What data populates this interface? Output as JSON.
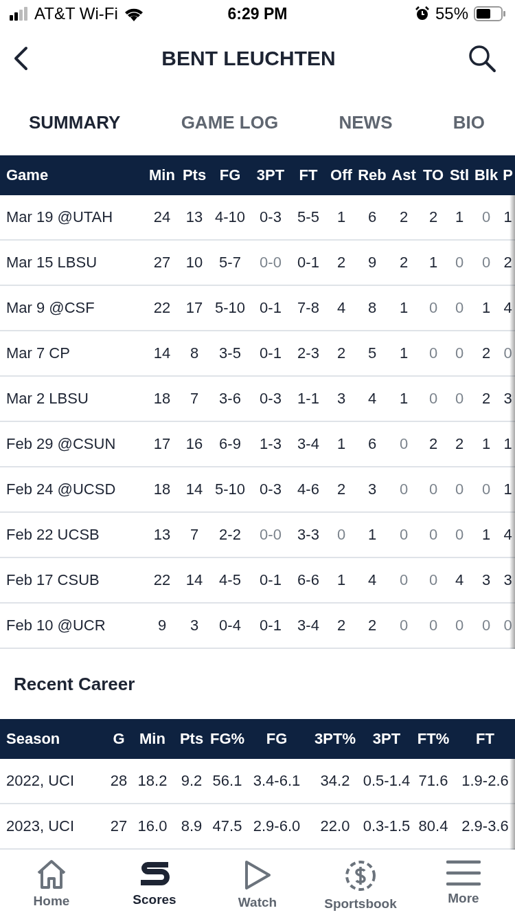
{
  "status_bar": {
    "carrier": "AT&T Wi-Fi",
    "time": "6:29 PM",
    "battery": "55%"
  },
  "header": {
    "title": "BENT LEUCHTEN"
  },
  "tabs": [
    {
      "label": "SUMMARY",
      "selected": true
    },
    {
      "label": "GAME LOG",
      "selected": false
    },
    {
      "label": "NEWS",
      "selected": false
    },
    {
      "label": "BIO",
      "selected": false
    }
  ],
  "game_log": {
    "columns": [
      "Game",
      "Min",
      "Pts",
      "FG",
      "3PT",
      "FT",
      "Off",
      "Reb",
      "Ast",
      "TO",
      "Stl",
      "Blk",
      "P"
    ],
    "rows": [
      {
        "cells": [
          "Mar 19 @UTAH",
          "24",
          "13",
          "4-10",
          "0-3",
          "5-5",
          "1",
          "6",
          "2",
          "2",
          "1",
          "0",
          "1"
        ],
        "muted": [
          false,
          false,
          false,
          false,
          false,
          false,
          false,
          false,
          false,
          false,
          false,
          true,
          false
        ]
      },
      {
        "cells": [
          "Mar 15 LBSU",
          "27",
          "10",
          "5-7",
          "0-0",
          "0-1",
          "2",
          "9",
          "2",
          "1",
          "0",
          "0",
          "2"
        ],
        "muted": [
          false,
          false,
          false,
          false,
          true,
          false,
          false,
          false,
          false,
          false,
          true,
          true,
          false
        ]
      },
      {
        "cells": [
          "Mar 9 @CSF",
          "22",
          "17",
          "5-10",
          "0-1",
          "7-8",
          "4",
          "8",
          "1",
          "0",
          "0",
          "1",
          "4"
        ],
        "muted": [
          false,
          false,
          false,
          false,
          false,
          false,
          false,
          false,
          false,
          true,
          true,
          false,
          false
        ]
      },
      {
        "cells": [
          "Mar 7 CP",
          "14",
          "8",
          "3-5",
          "0-1",
          "2-3",
          "2",
          "5",
          "1",
          "0",
          "0",
          "2",
          "0"
        ],
        "muted": [
          false,
          false,
          false,
          false,
          false,
          false,
          false,
          false,
          false,
          true,
          true,
          false,
          true
        ]
      },
      {
        "cells": [
          "Mar 2 LBSU",
          "18",
          "7",
          "3-6",
          "0-3",
          "1-1",
          "3",
          "4",
          "1",
          "0",
          "0",
          "2",
          "3"
        ],
        "muted": [
          false,
          false,
          false,
          false,
          false,
          false,
          false,
          false,
          false,
          true,
          true,
          false,
          false
        ]
      },
      {
        "cells": [
          "Feb 29 @CSUN",
          "17",
          "16",
          "6-9",
          "1-3",
          "3-4",
          "1",
          "6",
          "0",
          "2",
          "2",
          "1",
          "1"
        ],
        "muted": [
          false,
          false,
          false,
          false,
          false,
          false,
          false,
          false,
          true,
          false,
          false,
          false,
          false
        ]
      },
      {
        "cells": [
          "Feb 24 @UCSD",
          "18",
          "14",
          "5-10",
          "0-3",
          "4-6",
          "2",
          "3",
          "0",
          "0",
          "0",
          "0",
          "1"
        ],
        "muted": [
          false,
          false,
          false,
          false,
          false,
          false,
          false,
          false,
          true,
          true,
          true,
          true,
          false
        ]
      },
      {
        "cells": [
          "Feb 22 UCSB",
          "13",
          "7",
          "2-2",
          "0-0",
          "3-3",
          "0",
          "1",
          "0",
          "0",
          "0",
          "1",
          "4"
        ],
        "muted": [
          false,
          false,
          false,
          false,
          true,
          false,
          true,
          false,
          true,
          true,
          true,
          false,
          false
        ]
      },
      {
        "cells": [
          "Feb 17 CSUB",
          "22",
          "14",
          "4-5",
          "0-1",
          "6-6",
          "1",
          "4",
          "0",
          "0",
          "4",
          "3",
          "3"
        ],
        "muted": [
          false,
          false,
          false,
          false,
          false,
          false,
          false,
          false,
          true,
          true,
          false,
          false,
          false
        ]
      },
      {
        "cells": [
          "Feb 10 @UCR",
          "9",
          "3",
          "0-4",
          "0-1",
          "3-4",
          "2",
          "2",
          "0",
          "0",
          "0",
          "0",
          "0"
        ],
        "muted": [
          false,
          false,
          false,
          false,
          false,
          false,
          false,
          false,
          true,
          true,
          true,
          true,
          true
        ]
      }
    ]
  },
  "recent_career": {
    "title": "Recent Career",
    "columns": [
      "Season",
      "G",
      "Min",
      "Pts",
      "FG%",
      "FG",
      "3PT%",
      "3PT",
      "FT%",
      "FT"
    ],
    "rows": [
      {
        "cells": [
          "2022, UCI",
          "28",
          "18.2",
          "9.2",
          "56.1",
          "3.4-6.1",
          "34.2",
          "0.5-1.4",
          "71.6",
          "1.9-2.6"
        ]
      },
      {
        "cells": [
          "2023, UCI",
          "27",
          "16.0",
          "8.9",
          "47.5",
          "2.9-6.0",
          "22.0",
          "0.3-1.5",
          "80.4",
          "2.9-3.6"
        ]
      }
    ]
  },
  "bottom_nav": [
    {
      "kind": "home",
      "label": "Home",
      "selected": false
    },
    {
      "kind": "scores",
      "label": "Scores",
      "selected": true
    },
    {
      "kind": "watch",
      "label": "Watch",
      "selected": false
    },
    {
      "kind": "sportsbook",
      "label": "Sportsbook",
      "selected": false
    },
    {
      "kind": "more",
      "label": "More",
      "selected": false
    }
  ]
}
